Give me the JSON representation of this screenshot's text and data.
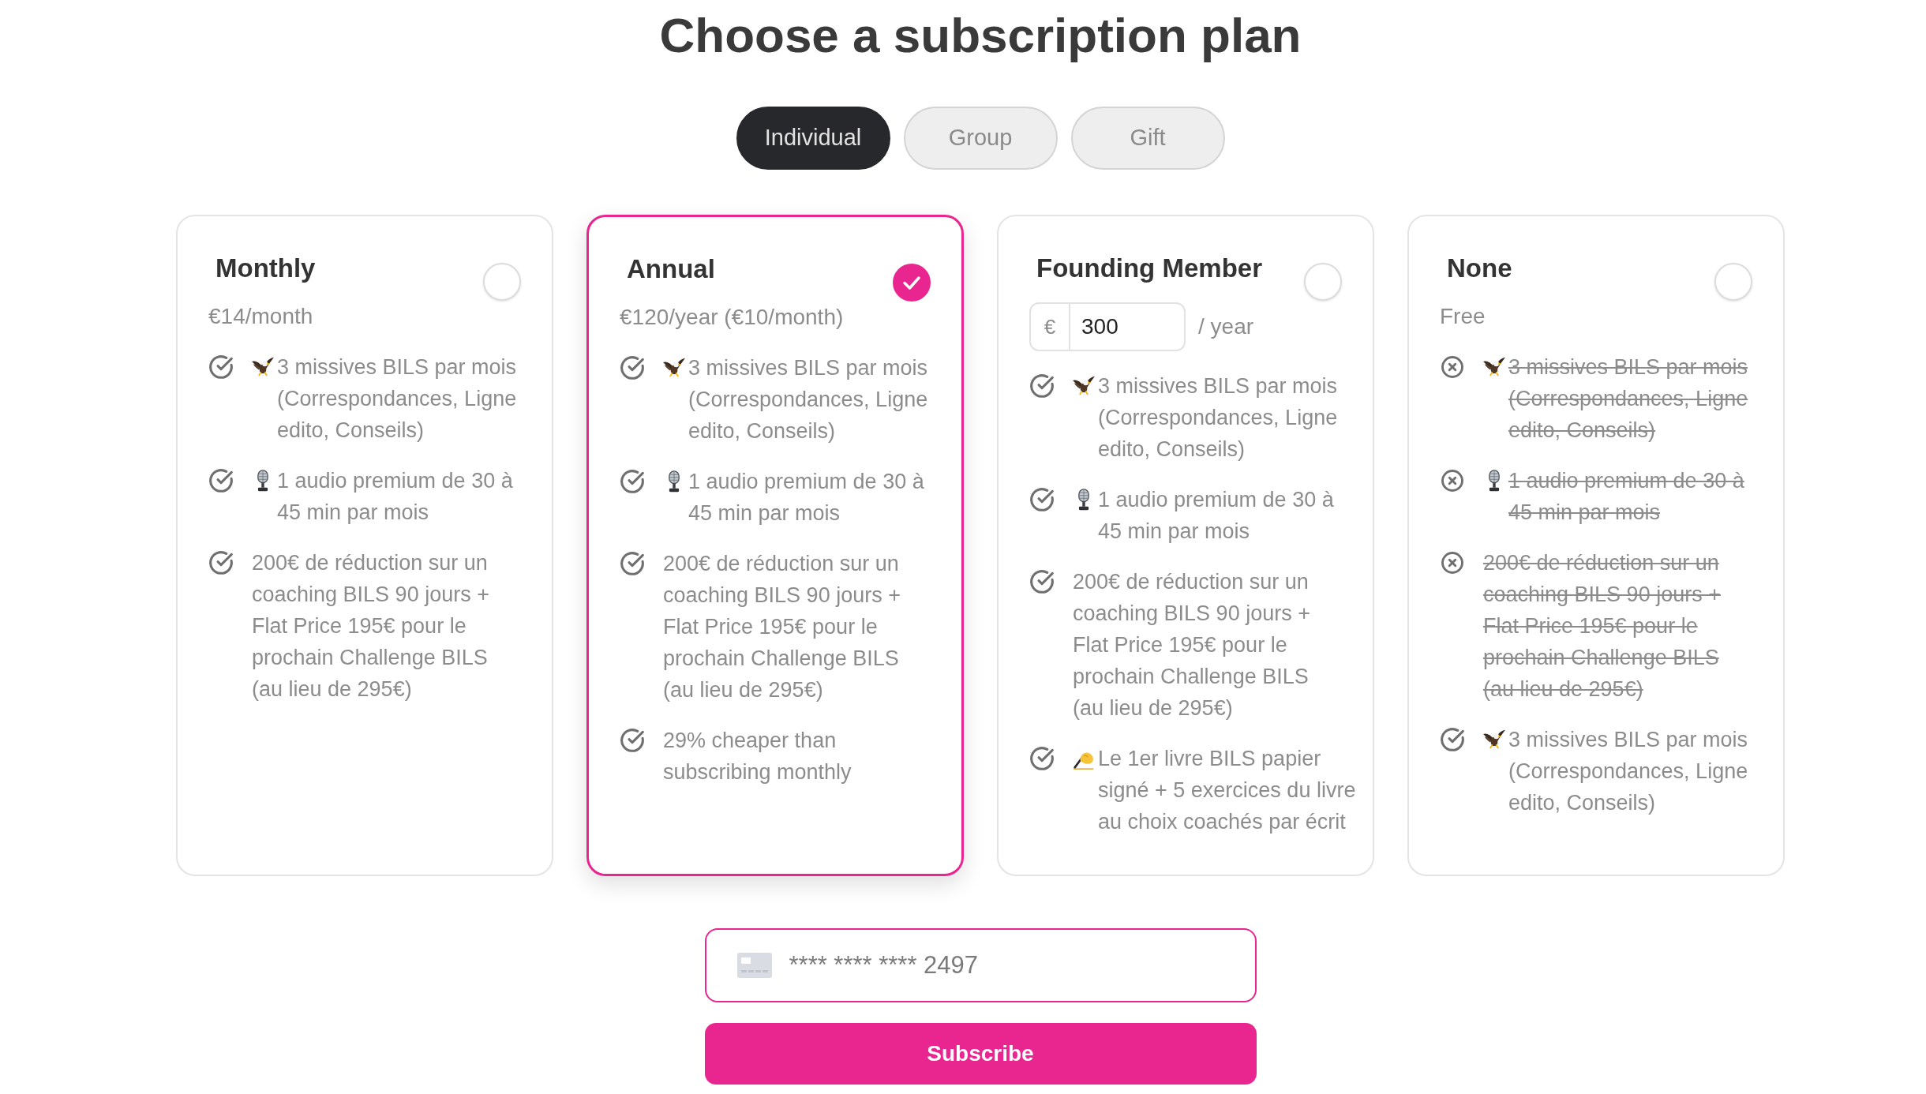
{
  "title": "Choose a subscription plan",
  "tabs": [
    {
      "label": "Individual",
      "selected": true
    },
    {
      "label": "Group",
      "selected": false
    },
    {
      "label": "Gift",
      "selected": false
    }
  ],
  "plans": [
    {
      "name": "Monthly",
      "selected": false,
      "price": {
        "kind": "text",
        "text": "€14/month"
      },
      "features": [
        {
          "kind": "letters",
          "included": true,
          "text": "3 missives BILS par mois (Correspondances, Ligne edito, Conseils)"
        },
        {
          "kind": "audio",
          "included": true,
          "text": "1 audio premium de 30 à 45 min par mois"
        },
        {
          "kind": "text",
          "included": true,
          "text": "200€ de réduction sur un coaching BILS 90 jours + Flat Price 195€ pour le prochain Challenge BILS (au lieu de 295€)"
        }
      ]
    },
    {
      "name": "Annual",
      "selected": true,
      "price": {
        "kind": "text",
        "text": "€120/year (€10/month)"
      },
      "features": [
        {
          "kind": "letters",
          "included": true,
          "text": "3 missives BILS par mois (Correspondances, Ligne edito, Conseils)"
        },
        {
          "kind": "audio",
          "included": true,
          "text": "1 audio premium de 30 à 45 min par mois"
        },
        {
          "kind": "text",
          "included": true,
          "text": "200€ de réduction sur un coaching BILS 90 jours + Flat Price 195€ pour le prochain Challenge BILS (au lieu de 295€)"
        },
        {
          "kind": "text",
          "included": true,
          "text": "29% cheaper than subscribing monthly"
        }
      ]
    },
    {
      "name": "Founding Member",
      "selected": false,
      "price": {
        "kind": "input",
        "prefix": "€",
        "value": "300",
        "suffix": "/ year"
      },
      "features": [
        {
          "kind": "letters",
          "included": true,
          "text": "3 missives BILS par mois (Correspondances, Ligne edito, Conseils)"
        },
        {
          "kind": "audio",
          "included": true,
          "text": "1 audio premium de 30 à 45 min par mois"
        },
        {
          "kind": "text",
          "included": true,
          "text": "200€ de réduction sur un coaching BILS 90 jours + Flat Price 195€ pour le prochain Challenge BILS (au lieu de 295€)"
        },
        {
          "kind": "book",
          "included": true,
          "text": "Le 1er livre BILS papier signé + 5 exercices du livre au choix coachés par écrit"
        }
      ]
    },
    {
      "name": "None",
      "selected": false,
      "price": {
        "kind": "text",
        "text": "Free"
      },
      "features": [
        {
          "kind": "letters",
          "included": false,
          "text": "3 missives BILS par mois (Correspondances, Ligne edito, Conseils)"
        },
        {
          "kind": "audio",
          "included": false,
          "text": "1 audio premium de 30 à 45 min par mois"
        },
        {
          "kind": "text",
          "included": false,
          "text": "200€ de réduction sur un coaching BILS 90 jours + Flat Price 195€ pour le prochain Challenge BILS (au lieu de 295€)"
        },
        {
          "kind": "letters",
          "included": true,
          "text": "3 missives BILS par mois (Correspondances, Ligne edito, Conseils)"
        }
      ]
    }
  ],
  "card_field": {
    "value": "**** **** **** 2497",
    "focused": true
  },
  "subscribe_button": {
    "label": "Subscribe"
  }
}
